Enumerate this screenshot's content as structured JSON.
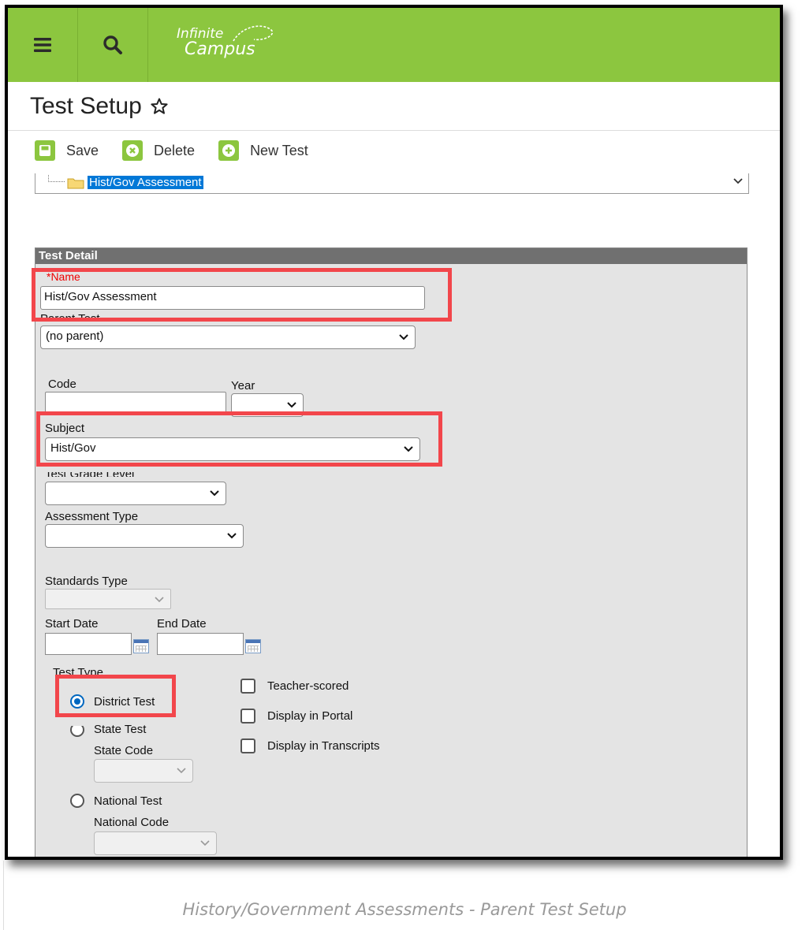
{
  "header": {
    "logo_line1": "Infinite",
    "logo_line2": "Campus"
  },
  "page": {
    "title": "Test Setup"
  },
  "toolbar": {
    "save_label": "Save",
    "delete_label": "Delete",
    "new_test_label": "New Test"
  },
  "tree": {
    "selected_item": "Hist/Gov Assessment"
  },
  "detail": {
    "section_title": "Test Detail",
    "name_label": "*Name",
    "name_value": "Hist/Gov Assessment",
    "parent_label": "Parent Test",
    "parent_value": "(no parent)",
    "code_label": "Code",
    "code_value": "",
    "year_label": "Year",
    "year_value": "",
    "subject_label": "Subject",
    "subject_value": "Hist/Gov",
    "grade_label": "Test Grade Level",
    "grade_value": "",
    "assessment_type_label": "Assessment Type",
    "assessment_type_value": "",
    "standards_type_label": "Standards Type",
    "start_date_label": "Start Date",
    "end_date_label": "End Date",
    "test_type_label": "Test Type",
    "district_test_label": "District Test",
    "state_test_label": "State Test",
    "state_code_label": "State Code",
    "national_test_label": "National Test",
    "national_code_label": "National Code",
    "teacher_scored_label": "Teacher-scored",
    "display_portal_label": "Display in Portal",
    "display_transcripts_label": "Display in Transcripts",
    "selected_test_type": "District Test"
  },
  "caption": "History/Government Assessments - Parent Test Setup",
  "colors": {
    "brand_green": "#8cc63f",
    "highlight_red": "#f2464b",
    "selection_blue": "#0078d7"
  }
}
